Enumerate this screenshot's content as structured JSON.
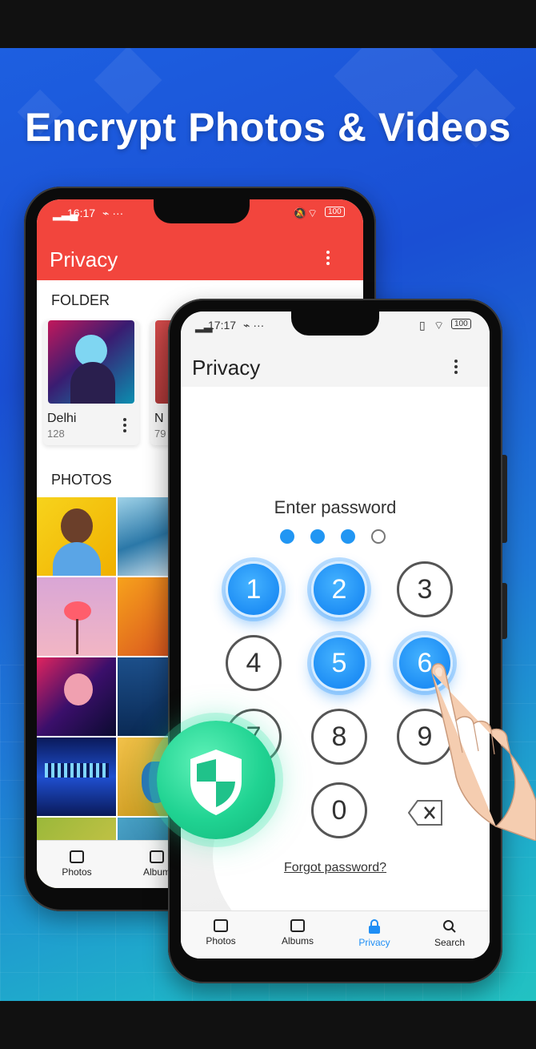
{
  "headline": "Encrypt Photos & Videos",
  "back_phone": {
    "status": {
      "time": "16:17",
      "battery": "100"
    },
    "appbar": {
      "title": "Privacy"
    },
    "folder_section_label": "FOLDER",
    "folders": [
      {
        "name": "Delhi",
        "count": "128"
      },
      {
        "name": "N",
        "count": "79"
      }
    ],
    "photos_section_label": "PHOTOS",
    "nav": [
      {
        "label": "Photos",
        "icon": "photo-icon"
      },
      {
        "label": "Album",
        "icon": "albums-icon"
      }
    ]
  },
  "front_phone": {
    "status": {
      "time": "17:17",
      "battery": "100"
    },
    "appbar": {
      "title": "Privacy"
    },
    "prompt": "Enter password",
    "pin_dots": {
      "filled": 3,
      "total": 4
    },
    "keys": [
      "1",
      "2",
      "3",
      "4",
      "5",
      "6",
      "7",
      "8",
      "9",
      "0"
    ],
    "pressed_keys": [
      "1",
      "2",
      "5",
      "6"
    ],
    "forgot": "Forgot password?",
    "nav": [
      {
        "label": "Photos",
        "icon": "photo-icon"
      },
      {
        "label": "Albums",
        "icon": "albums-icon"
      },
      {
        "label": "Privacy",
        "icon": "lock-icon",
        "active": true
      },
      {
        "label": "Search",
        "icon": "search-icon"
      }
    ]
  },
  "colors": {
    "accent_red": "#f2453d",
    "accent_blue": "#1e8ef5",
    "shield_green": "#20d392"
  }
}
